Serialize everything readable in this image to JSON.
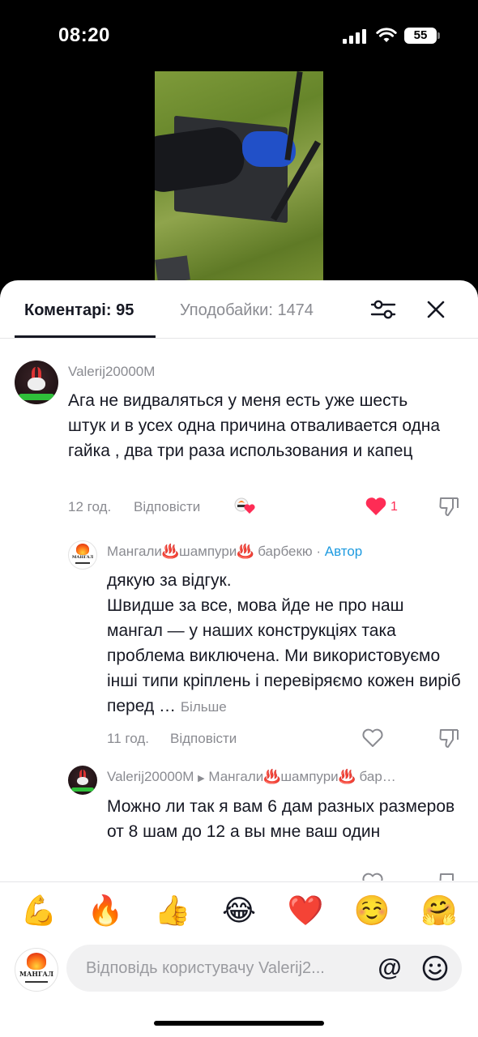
{
  "status": {
    "time": "08:20",
    "battery": "55"
  },
  "tabs": {
    "comments": "Коментарі: 95",
    "likes": "Уподобайки: 1474"
  },
  "comments": [
    {
      "user": "Valerij20000M",
      "text": "Ага не видваляться у меня есть уже шесть штук и в усех одна причина отваливается одна гайка , два три раза использования и капец",
      "time": "12 год.",
      "reply_label": "Відповісти",
      "likes": "1",
      "liked": true
    },
    {
      "user": "Мангали♨️шампури♨️ барбекю",
      "author_sep": " · ",
      "author_tag": "Автор",
      "text": "дякую за відгук.\nШвидше за все, мова йде не про наш мангал — у наших конструкціях така проблема виключена. Ми використовуємо інші типи кріплень і перевіряємо кожен виріб перед …",
      "more": "Більше",
      "time": "11 год.",
      "reply_label": "Відповісти"
    },
    {
      "user": "Valerij20000M",
      "reply_to": "Мангали♨️шампури♨️ бар…",
      "text": "Можно ли так я вам 6 дам разных размеров от 8 шам до 12 а вы мне ваш один"
    }
  ],
  "emojis": [
    "💪",
    "🔥",
    "👍",
    "😂",
    "❤️",
    "☺️",
    "🤗"
  ],
  "input": {
    "placeholder": "Відповідь користувачу Valerij2..."
  },
  "avatar_mangal_text": "МАНГАЛ",
  "colors": {
    "accent": "#fe2c55",
    "author": "#1f9be0",
    "text": "#161823",
    "muted": "#8a8b91"
  }
}
